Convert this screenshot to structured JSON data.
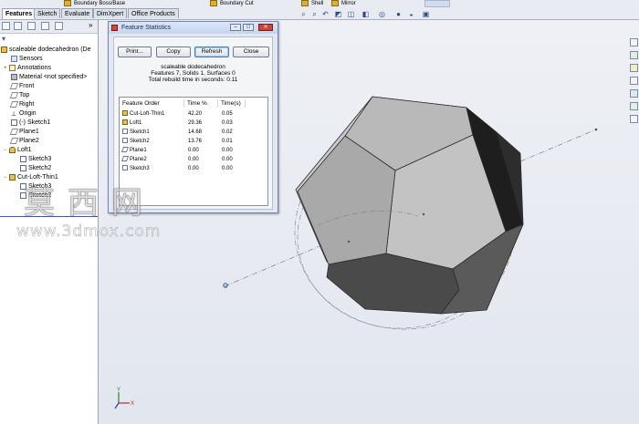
{
  "ribbon": {
    "items": [
      {
        "label": "Boundary Boss/Base",
        "icon": "boundary-boss-icon"
      },
      {
        "label": "Boundary Cut",
        "icon": "boundary-cut-icon"
      },
      {
        "label": "Shell",
        "icon": "shell-icon"
      },
      {
        "label": "Mirror",
        "icon": "mirror-icon"
      }
    ]
  },
  "command_tabs": [
    "Features",
    "Sketch",
    "Evaluate",
    "DimXpert",
    "Office Products"
  ],
  "active_tab": "Features",
  "view_toolbar": [
    "zoom-to-fit-icon",
    "zoom-area-icon",
    "previous-view-icon",
    "section-view-icon",
    "view-orientation-icon",
    "display-style-icon",
    "hide-show-items-icon",
    "edit-appearance-icon",
    "apply-scene-icon",
    "view-settings-icon"
  ],
  "feature_manager": {
    "toolbar_icons": [
      "feature-manager-tab-icon",
      "property-manager-tab-icon",
      "configuration-manager-tab-icon",
      "dimxpert-manager-tab-icon",
      "display-manager-tab-icon"
    ],
    "overflow": "»",
    "filter_icon": "filter-icon",
    "tree": [
      {
        "label": "scaleable dodecahedron  (De",
        "icon": "part-icon",
        "level": 0
      },
      {
        "label": "Sensors",
        "icon": "sensors-icon",
        "level": 1
      },
      {
        "label": "Annotations",
        "icon": "annotations-icon",
        "level": 1,
        "expandable": true
      },
      {
        "label": "Material <not specified>",
        "icon": "material-icon",
        "level": 1
      },
      {
        "label": "Front",
        "icon": "plane-icon",
        "level": 1
      },
      {
        "label": "Top",
        "icon": "plane-icon",
        "level": 1
      },
      {
        "label": "Right",
        "icon": "plane-icon",
        "level": 1
      },
      {
        "label": "Origin",
        "icon": "origin-icon",
        "level": 1
      },
      {
        "label": "(-) Sketch1",
        "icon": "sketch-icon",
        "level": 1
      },
      {
        "label": "Plane1",
        "icon": "plane-icon",
        "level": 1
      },
      {
        "label": "Plane2",
        "icon": "plane-icon",
        "level": 1
      },
      {
        "label": "Loft1",
        "icon": "loft-icon",
        "level": 1,
        "expandable": true
      },
      {
        "label": "Sketch3",
        "icon": "sketch-icon",
        "level": 2
      },
      {
        "label": "Sketch2",
        "icon": "sketch-icon",
        "level": 2
      },
      {
        "label": "Cut-Loft-Thin1",
        "icon": "cut-loft-icon",
        "level": 1,
        "expandable": true
      },
      {
        "label": "Sketch3",
        "icon": "sketch-icon",
        "level": 2
      },
      {
        "label": "Sketch2",
        "icon": "sketch-icon",
        "level": 2
      }
    ]
  },
  "dialog": {
    "title": "Feature Statistics",
    "buttons": {
      "print": "Print...",
      "copy": "Copy",
      "refresh": "Refresh",
      "close": "Close"
    },
    "part_name": "scaleable dodecahedron",
    "summary": "Features 7, Solids 1, Surfaces 0",
    "rebuild": "Total rebuild time in seconds: 0.11",
    "columns": [
      "Feature Order",
      "Time %",
      "Time(s)"
    ],
    "rows": [
      {
        "name": "Cut-Loft-Thin1",
        "pct": "42.20",
        "time": "0.05",
        "icon": "cut-loft-icon"
      },
      {
        "name": "Loft1",
        "pct": "29.36",
        "time": "0.03",
        "icon": "loft-icon"
      },
      {
        "name": "Sketch1",
        "pct": "14.68",
        "time": "0.02",
        "icon": "sketch-icon"
      },
      {
        "name": "Sketch2",
        "pct": "13.76",
        "time": "0.01",
        "icon": "sketch-icon"
      },
      {
        "name": "Plane1",
        "pct": "0.00",
        "time": "0.00",
        "icon": "plane-icon"
      },
      {
        "name": "Plane2",
        "pct": "0.00",
        "time": "0.00",
        "icon": "plane-icon"
      },
      {
        "name": "Sketch3",
        "pct": "0.00",
        "time": "0.00",
        "icon": "sketch-icon"
      }
    ]
  },
  "watermark": {
    "chinese": "莫西网",
    "url": "www.3dmox.com"
  },
  "triad": {
    "x": "X",
    "y": "Y"
  },
  "colors": {
    "face_light": "#b4b4b4",
    "face_dark": "#3a3a3a",
    "dialog_accent": "#3c7fd0"
  }
}
